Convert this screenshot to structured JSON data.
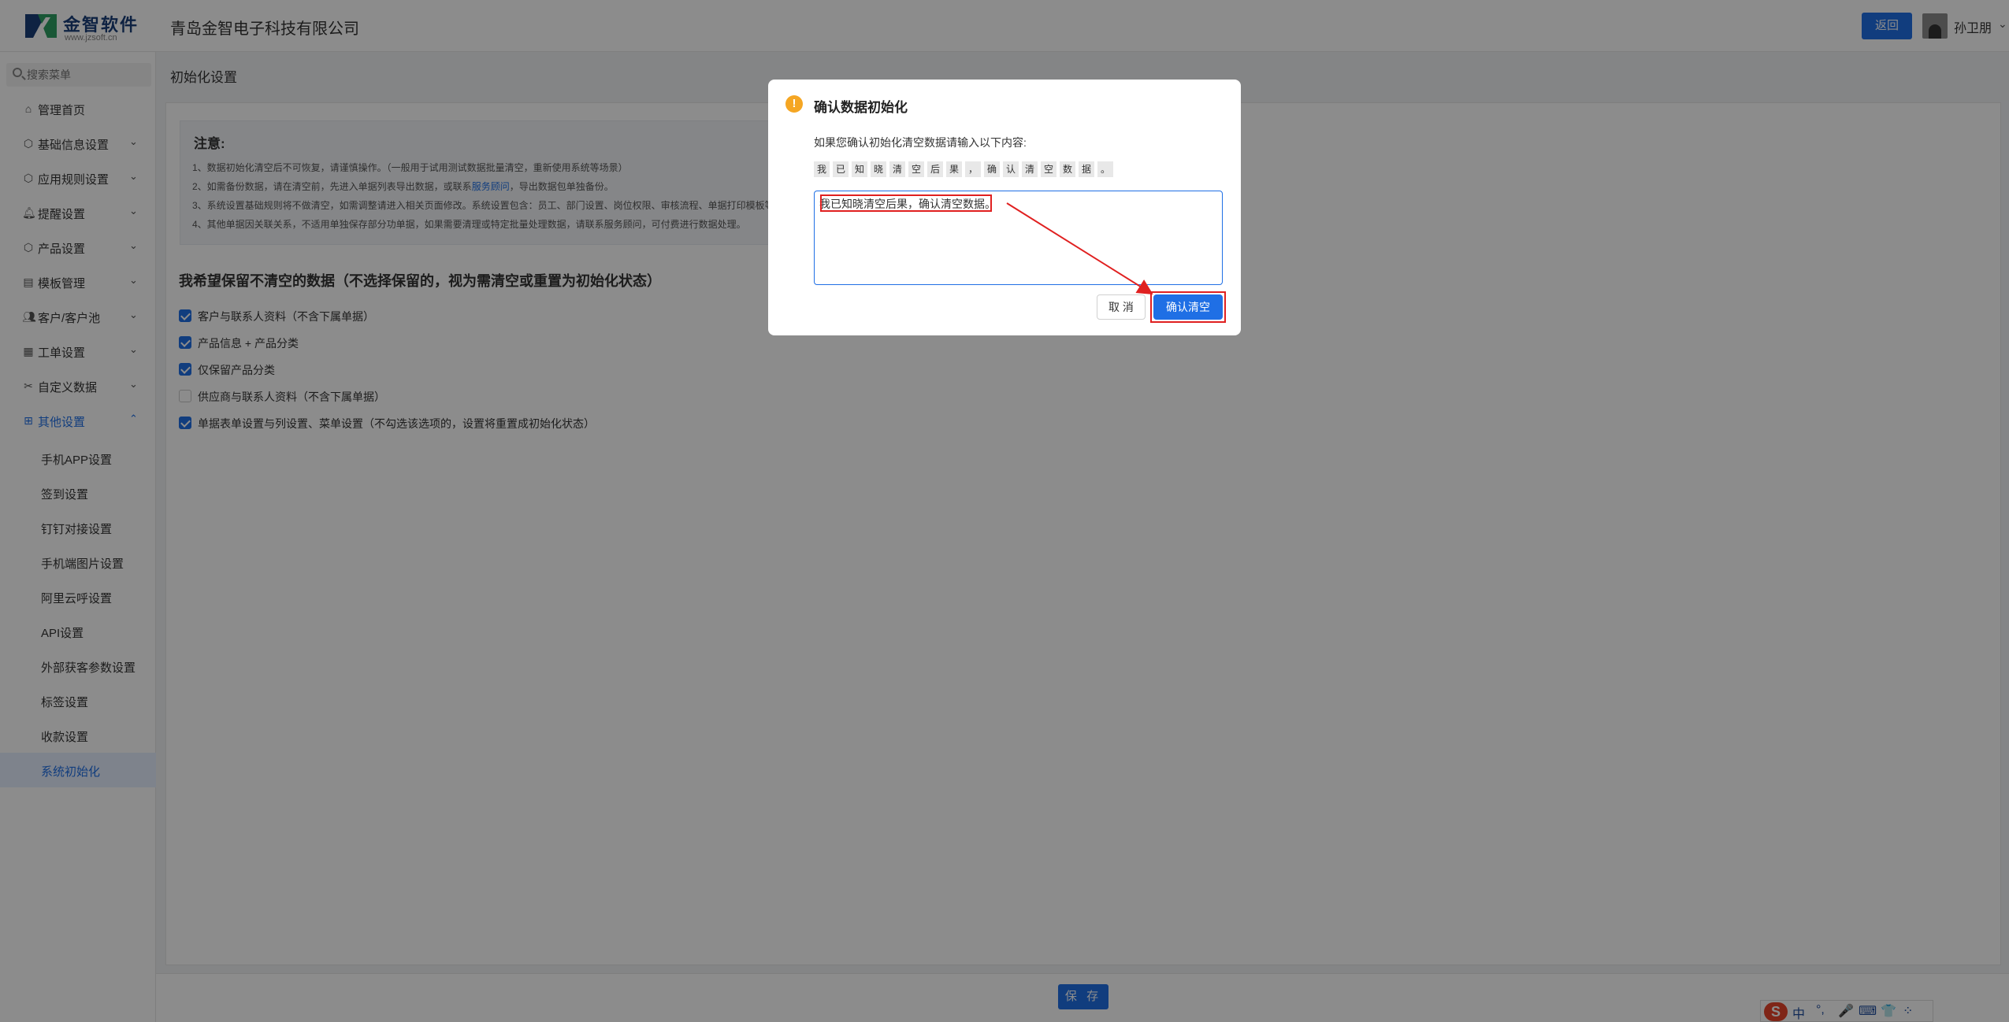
{
  "header": {
    "logo_title": "金智软件",
    "logo_sub": "www.jzsoft.cn",
    "company": "青岛金智电子科技有限公司",
    "back_label": "返回",
    "username": "孙卫朋"
  },
  "sidebar": {
    "search_placeholder": "搜索菜单",
    "items": [
      {
        "label": "管理首页",
        "icon": "home-icon",
        "has_children": false
      },
      {
        "label": "基础信息设置",
        "icon": "cube-icon",
        "has_children": true
      },
      {
        "label": "应用规则设置",
        "icon": "cube-icon",
        "has_children": true
      },
      {
        "label": "提醒设置",
        "icon": "bell-icon",
        "has_children": true
      },
      {
        "label": "产品设置",
        "icon": "cube-icon",
        "has_children": true
      },
      {
        "label": "模板管理",
        "icon": "template-icon",
        "has_children": true
      },
      {
        "label": "客户/客户池",
        "icon": "users-icon",
        "has_children": true
      },
      {
        "label": "工单设置",
        "icon": "form-icon",
        "has_children": true
      },
      {
        "label": "自定义数据",
        "icon": "tools-icon",
        "has_children": true
      },
      {
        "label": "其他设置",
        "icon": "grid-icon",
        "has_children": true,
        "expanded": true
      }
    ],
    "subitems": [
      "手机APP设置",
      "签到设置",
      "钉钉对接设置",
      "手机端图片设置",
      "阿里云呼设置",
      "API设置",
      "外部获客参数设置",
      "标签设置",
      "收款设置",
      "系统初始化"
    ],
    "selected_subitem": "系统初始化"
  },
  "main": {
    "page_title": "初始化设置",
    "note_title": "注意:",
    "note_lines": [
      "1、数据初始化清空后不可恢复，请谨慎操作。（一般用于试用测试数据批量清空，重新使用系统等场景）",
      "2、如需备份数据，请在清空前，先进入单据列表导出数据，或联系",
      "3、系统设置基础规则将不做清空，如需调整请进入相关页面修改。系统设置包含：员工、部门设置、岗位权限、审核流程、单据打印模板等",
      "4、其他单据因关联关系，不适用单独保存部分功单据，如果需要清理或特定批量处理数据，请联系服务顾问，可付费进行数据处理。"
    ],
    "note_line2_link": "服务顾问",
    "note_line2_tail": "，导出数据包单独备份。",
    "keep_title": "我希望保留不清空的数据（不选择保留的，视为需清空或重置为初始化状态）",
    "checkboxes": [
      {
        "label": "客户与联系人资料（不含下属单据）",
        "checked": true
      },
      {
        "label": "产品信息 + 产品分类",
        "checked": true
      },
      {
        "label": "仅保留产品分类",
        "checked": true
      },
      {
        "label": "供应商与联系人资料（不含下属单据）",
        "checked": false
      },
      {
        "label": "单据表单设置与列设置、菜单设置（不勾选该选项的，设置将重置成初始化状态）",
        "checked": true
      }
    ],
    "save_label": "保 存"
  },
  "modal": {
    "title": "确认数据初始化",
    "description": "如果您确认初始化清空数据请输入以下内容:",
    "chars": [
      "我",
      "已",
      "知",
      "晓",
      "清",
      "空",
      "后",
      "果",
      "，",
      "确",
      "认",
      "清",
      "空",
      "数",
      "据",
      "。"
    ],
    "input_value": "我已知晓清空后果，确认清空数据。",
    "cancel_label": "取 消",
    "confirm_label": "确认清空"
  },
  "ime": {
    "logo": "S",
    "items": [
      "中",
      "°,",
      "🎤",
      "⌨",
      "👕",
      "⁘"
    ]
  },
  "colors": {
    "primary": "#1f6fe5",
    "warning": "#f5a623",
    "annotation": "#e02020"
  }
}
